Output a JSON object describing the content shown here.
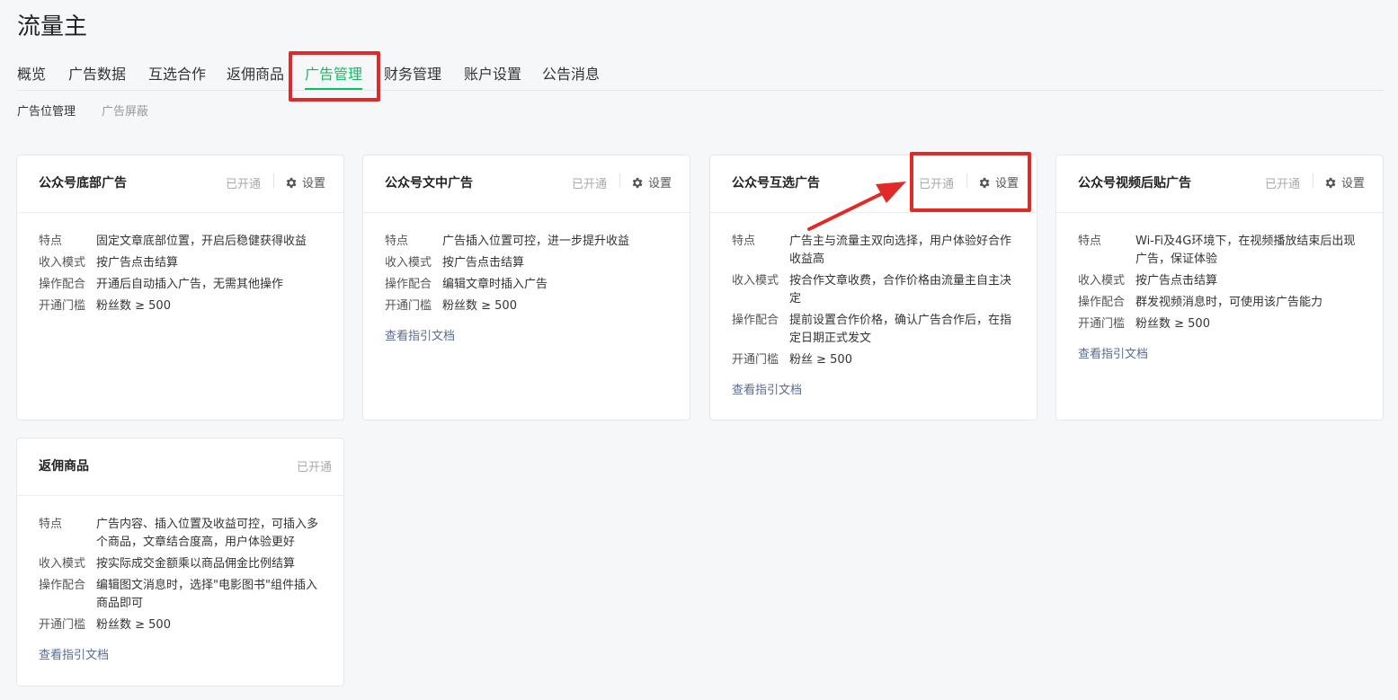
{
  "app_title": "流量主",
  "main_tabs": [
    "概览",
    "广告数据",
    "互选合作",
    "返佣商品",
    "广告管理",
    "财务管理",
    "账户设置",
    "公告消息"
  ],
  "active_tab_index": 4,
  "sub_tabs": [
    "广告位管理",
    "广告屏蔽"
  ],
  "row_labels": {
    "feature": "特点",
    "income": "收入模式",
    "operation": "操作配合",
    "threshold": "开通门槛"
  },
  "cards": [
    {
      "title": "公众号底部广告",
      "status": "已开通",
      "settings_label": "设置",
      "feature": "固定文章底部位置，开启后稳健获得收益",
      "income": "按广告点击结算",
      "operation": "开通后自动插入广告，无需其他操作",
      "threshold": "粉丝数 ≥ 500"
    },
    {
      "title": "公众号文中广告",
      "status": "已开通",
      "settings_label": "设置",
      "feature": "广告插入位置可控，进一步提升收益",
      "income": "按广告点击结算",
      "operation": "编辑文章时插入广告",
      "threshold": "粉丝数 ≥ 500",
      "doc_link": "查看指引文档"
    },
    {
      "title": "公众号互选广告",
      "status": "已开通",
      "settings_label": "设置",
      "feature": "广告主与流量主双向选择，用户体验好合作收益高",
      "income": "按合作文章收费，合作价格由流量主自主决定",
      "operation": "提前设置合作价格，确认广告合作后，在指定日期正式发文",
      "threshold": "粉丝 ≥ 500",
      "doc_link": "查看指引文档"
    },
    {
      "title": "公众号视频后贴广告",
      "status": "已开通",
      "settings_label": "设置",
      "feature": "Wi-Fi及4G环境下，在视频播放结束后出现广告，保证体验",
      "income": "按广告点击结算",
      "operation": "群发视频消息时，可使用该广告能力",
      "threshold": "粉丝数 ≥ 500",
      "doc_link": "查看指引文档"
    },
    {
      "title": "返佣商品",
      "status": "已开通",
      "feature": "广告内容、插入位置及收益可控，可插入多个商品，文章结合度高，用户体验更好",
      "income": "按实际成交金额乘以商品佣金比例结算",
      "operation": "编辑图文消息时，选择\"电影图书\"组件插入商品即可",
      "threshold": "粉丝数 ≥ 500",
      "doc_link": "查看指引文档"
    }
  ],
  "colors": {
    "accent": "#07c160",
    "link": "#576b95",
    "annotation": "#e02a2a"
  },
  "icons": [
    "gear-icon",
    "annotation-arrow"
  ]
}
